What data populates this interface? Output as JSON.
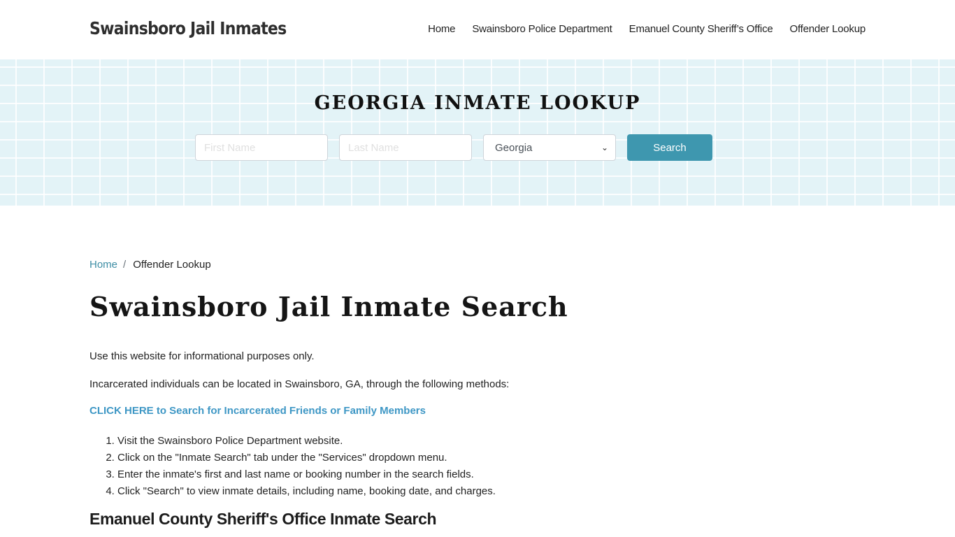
{
  "header": {
    "brand": "Swainsboro Jail Inmates",
    "nav": [
      {
        "label": "Home"
      },
      {
        "label": "Swainsboro Police Department"
      },
      {
        "label": "Emanuel County Sheriff’s Office"
      },
      {
        "label": "Offender Lookup"
      }
    ]
  },
  "hero": {
    "title": "GEORGIA INMATE LOOKUP",
    "first_name_placeholder": "First Name",
    "last_name_placeholder": "Last Name",
    "state_selected": "Georgia",
    "search_label": "Search",
    "accent_color": "#3e97af"
  },
  "breadcrumb": {
    "home": "Home",
    "separator": "/",
    "current": "Offender Lookup"
  },
  "main": {
    "title": "Swainsboro Jail Inmate Search",
    "paragraphs": [
      "Use this website for informational purposes only.",
      "Incarcerated individuals can be located in Swainsboro, GA, through the following methods:"
    ],
    "cta_link": "CLICK HERE to Search for Incarcerated Friends or Family Members",
    "steps": [
      "Visit the Swainsboro Police Department website.",
      "Click on the \"Inmate Search\" tab under the \"Services\" dropdown menu.",
      "Enter the inmate's first and last name or booking number in the search fields.",
      "Click \"Search\" to view inmate details, including name, booking date, and charges."
    ],
    "section_heading": "Emanuel County Sheriff's Office Inmate Search"
  }
}
